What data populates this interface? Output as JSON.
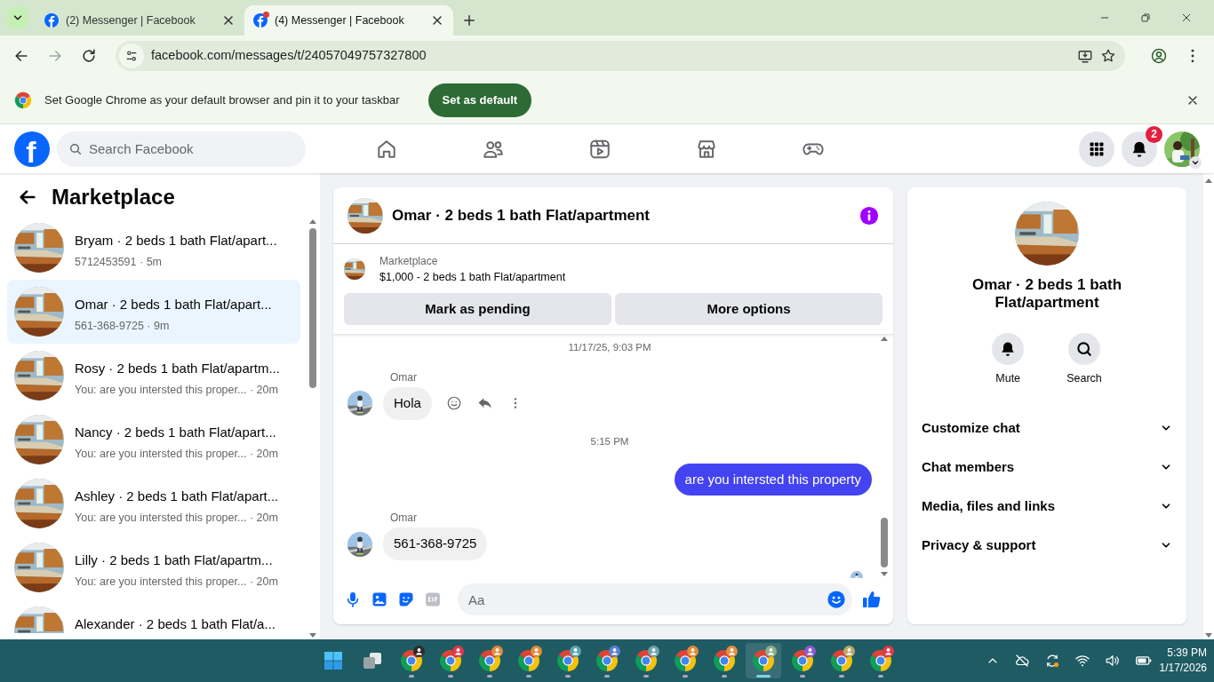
{
  "browser": {
    "tabs": [
      {
        "title": "(2) Messenger | Facebook",
        "selected": false,
        "notification_dot": false
      },
      {
        "title": "(4) Messenger | Facebook",
        "selected": true,
        "notification_dot": true
      }
    ],
    "address": "facebook.com/messages/t/24057049757327800",
    "infobar": {
      "text": "Set Google Chrome as your default browser and pin it to your taskbar",
      "button": "Set as default"
    }
  },
  "facebook": {
    "logo": "f",
    "search_placeholder": "Search Facebook",
    "notification_count": "2"
  },
  "sidebar": {
    "title": "Marketplace",
    "conversations": [
      {
        "title": "Bryam · 2 beds 1 bath Flat/apart...",
        "subtitle": "5712453591 · 5m",
        "selected": false
      },
      {
        "title": "Omar · 2 beds 1 bath Flat/apart...",
        "subtitle": "561-368-9725 · 9m",
        "selected": true
      },
      {
        "title": "Rosy · 2 beds 1 bath Flat/apartm...",
        "subtitle": "You: are you intersted this proper... · 20m",
        "selected": false
      },
      {
        "title": "Nancy · 2 beds 1 bath Flat/apart...",
        "subtitle": "You: are you intersted this proper... · 20m",
        "selected": false
      },
      {
        "title": "Ashley · 2 beds 1 bath Flat/apart...",
        "subtitle": "You: are you intersted this proper... · 20m",
        "selected": false
      },
      {
        "title": "Lilly · 2 beds 1 bath Flat/apartm...",
        "subtitle": "You: are you intersted this proper... · 20m",
        "selected": false
      },
      {
        "title": "Alexander · 2 beds 1 bath Flat/a...",
        "selected": false
      }
    ]
  },
  "chat": {
    "title": "Omar · 2 beds 1 bath Flat/apartment",
    "listing": {
      "source": "Marketplace",
      "text": "$1,000 - 2 beds 1 bath Flat/apartment",
      "buttons": [
        "Mark as pending",
        "More options"
      ]
    },
    "messages": [
      {
        "kind": "timestamp",
        "text": "11/17/25, 9:03 PM"
      },
      {
        "kind": "incoming",
        "sender": "Omar",
        "text": "Hola",
        "hover_actions": true
      },
      {
        "kind": "timestamp",
        "text": "5:15 PM"
      },
      {
        "kind": "outgoing",
        "text": "are you intersted this property"
      },
      {
        "kind": "incoming",
        "sender": "Omar",
        "text": "561-368-9725",
        "hover_actions": false
      }
    ],
    "seen_receipt": true,
    "composer": {
      "placeholder": "Aa"
    }
  },
  "details": {
    "name": "Omar · 2 beds 1 bath Flat/apartment",
    "actions": [
      {
        "kind": "mute",
        "label": "Mute"
      },
      {
        "kind": "search",
        "label": "Search"
      }
    ],
    "sections": [
      "Customize chat",
      "Chat members",
      "Media, files and links",
      "Privacy & support"
    ]
  },
  "taskbar": {
    "apps": [
      {
        "color": "#2b2b2b",
        "selected": false
      },
      {
        "color": "#e0394a",
        "selected": false
      },
      {
        "color": "#e38a3a",
        "selected": false
      },
      {
        "color": "#e38a3a",
        "selected": false
      },
      {
        "color": "#5aa6b3",
        "selected": false
      },
      {
        "color": "#5b7fd6",
        "selected": false
      },
      {
        "color": "#6fa3a8",
        "selected": false
      },
      {
        "color": "#e88a3a",
        "selected": false
      },
      {
        "color": "#e3903f",
        "selected": false
      },
      {
        "color": "#8bb08a",
        "selected": true
      },
      {
        "color": "#8a5cd6",
        "selected": false
      },
      {
        "color": "#b8a86a",
        "selected": false
      },
      {
        "color": "#e0394a",
        "selected": false
      }
    ],
    "time": "5:39 PM",
    "date": "1/17/2026"
  }
}
